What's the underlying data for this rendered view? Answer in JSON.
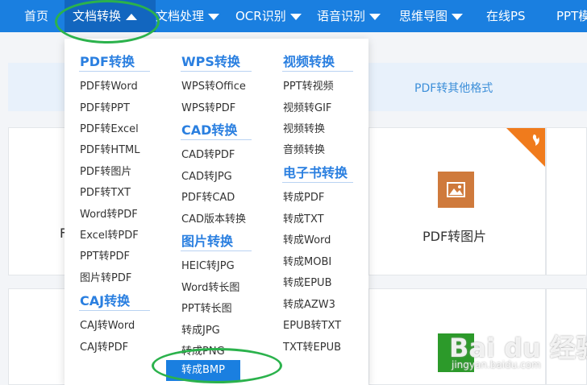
{
  "nav": {
    "items": [
      {
        "label": "首页"
      },
      {
        "label": "文档转换"
      },
      {
        "label": "文档处理"
      },
      {
        "label": "OCR识别"
      },
      {
        "label": "语音识别"
      },
      {
        "label": "思维导图"
      },
      {
        "label": "在线PS"
      },
      {
        "label": "PPT模"
      }
    ]
  },
  "banner": {
    "text": "PDF转其他格式"
  },
  "cards": {
    "pdf_to_image": "PDF转图片",
    "partial_left": "F"
  },
  "dropdown": {
    "col1": {
      "pdf_title": "PDF转换",
      "pdf_items": [
        "PDF转Word",
        "PDF转PPT",
        "PDF转Excel",
        "PDF转HTML",
        "PDF转图片",
        "PDF转TXT",
        "Word转PDF",
        "Excel转PDF",
        "PPT转PDF",
        "图片转PDF"
      ],
      "caj_title": "CAJ转换",
      "caj_items": [
        "CAJ转Word",
        "CAJ转PDF"
      ]
    },
    "col2": {
      "wps_title": "WPS转换",
      "wps_items": [
        "WPS转Office",
        "WPS转PDF"
      ],
      "cad_title": "CAD转换",
      "cad_items": [
        "CAD转PDF",
        "CAD转JPG",
        "PDF转CAD",
        "CAD版本转换"
      ],
      "img_title": "图片转换",
      "img_items": [
        "HEIC转JPG",
        "Word转长图",
        "PPT转长图",
        "转成JPG",
        "转成PNG",
        "转成BMP"
      ]
    },
    "col3": {
      "video_title": "视频转换",
      "video_items": [
        "PPT转视频",
        "视频转GIF",
        "视频转换",
        "音频转换"
      ],
      "ebook_title": "电子书转换",
      "ebook_items": [
        "转成PDF",
        "转成TXT",
        "转成Word",
        "转成MOBI",
        "转成EPUB",
        "转成AZW3",
        "EPUB转TXT",
        "TXT转EPUB"
      ]
    }
  },
  "watermark": {
    "logo": "Bai du 经验",
    "url": "jingyan.baidu.com"
  },
  "colors": {
    "nav": "#1a7fe0",
    "accent": "#2a7fe0",
    "annotation": "#2bb24c"
  }
}
